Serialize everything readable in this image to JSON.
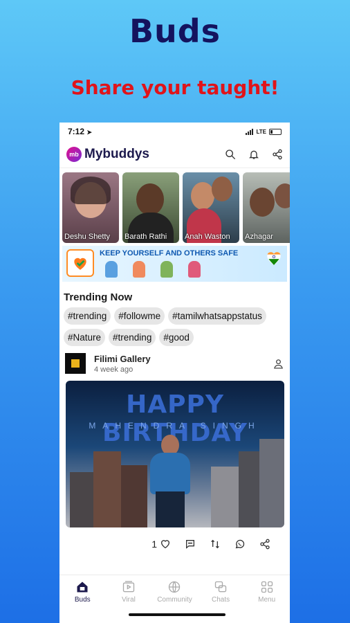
{
  "promo": {
    "title": "Buds",
    "subtitle": "Share your taught!"
  },
  "status_bar": {
    "time": "7:12",
    "network": "LTE"
  },
  "app": {
    "name": "Mybuddys",
    "logo_mark": "mb"
  },
  "stories": [
    {
      "name": "Deshu Shetty",
      "bg": "#7a5a66",
      "face": "#d9a892"
    },
    {
      "name": "Barath Rathi",
      "bg": "#6b7a58",
      "face": "#5b3a28"
    },
    {
      "name": "Anah Waston",
      "bg": "#4d6a7e",
      "face": "#b47c5c"
    },
    {
      "name": "Azhagar",
      "bg": "#8a8f8a",
      "face": "#6a4532"
    }
  ],
  "banner": {
    "text": "KEEP YOURSELF AND OTHERS SAFE"
  },
  "trending": {
    "title": "Trending Now",
    "tags": [
      "#trending",
      "#followme",
      "#tamilwhatsappstatus",
      "#Nature",
      "#trending",
      "#good"
    ]
  },
  "post": {
    "author": "Filimi Gallery",
    "time": "4 week ago",
    "image_title": "HAPPY BIRTHDAY",
    "image_subtitle": "MAHENDRA SINGH",
    "like_count": "1"
  },
  "nav": {
    "items": [
      {
        "label": "Buds",
        "icon": "home-icon"
      },
      {
        "label": "Viral",
        "icon": "video-icon"
      },
      {
        "label": "Community",
        "icon": "globe-icon"
      },
      {
        "label": "Chats",
        "icon": "chat-icon"
      },
      {
        "label": "Menu",
        "icon": "grid-icon"
      }
    ]
  },
  "colors": {
    "brand_dark": "#1d1a4d",
    "promo_title": "#14135e",
    "promo_subtitle": "#e0141a"
  }
}
